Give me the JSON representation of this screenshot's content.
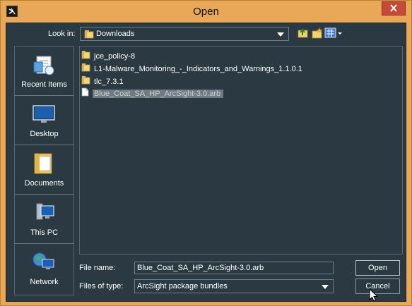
{
  "window": {
    "title": "Open"
  },
  "lookin": {
    "label": "Look in:",
    "value": "Downloads"
  },
  "places": [
    {
      "label": "Recent Items",
      "icon": "recent-items-icon"
    },
    {
      "label": "Desktop",
      "icon": "desktop-icon"
    },
    {
      "label": "Documents",
      "icon": "documents-icon"
    },
    {
      "label": "This PC",
      "icon": "this-pc-icon"
    },
    {
      "label": "Network",
      "icon": "network-icon"
    }
  ],
  "files": [
    {
      "name": "jce_policy-8",
      "type": "folder"
    },
    {
      "name": "L1-Malware_Monitoring_-_Indicators_and_Warnings_1.1.0.1",
      "type": "folder"
    },
    {
      "name": "tlc_7.3.1",
      "type": "folder"
    },
    {
      "name": "Blue_Coat_SA_HP_ArcSight-3.0.arb",
      "type": "file",
      "selected": true
    }
  ],
  "filename": {
    "label": "File name:",
    "value": "Blue_Coat_SA_HP_ArcSight-3.0.arb"
  },
  "filetype": {
    "label": "Files of type:",
    "value": "ArcSight package bundles"
  },
  "buttons": {
    "open": "Open",
    "cancel": "Cancel"
  }
}
